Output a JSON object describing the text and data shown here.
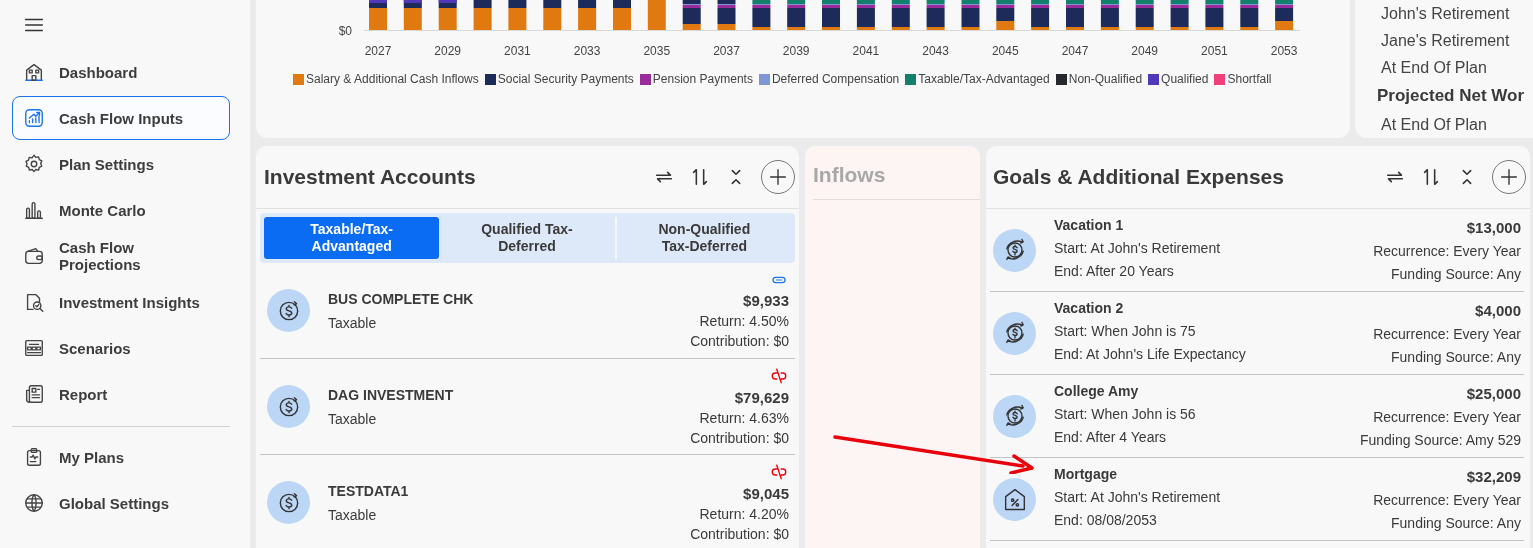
{
  "sidebar": {
    "items": [
      {
        "label": "Dashboard",
        "selected": false
      },
      {
        "label": "Cash Flow Inputs",
        "selected": true
      },
      {
        "label": "Plan Settings",
        "selected": false
      },
      {
        "label": "Monte Carlo",
        "selected": false
      },
      {
        "label": "Cash Flow Projections",
        "selected": false
      },
      {
        "label": "Investment Insights",
        "selected": false
      },
      {
        "label": "Scenarios",
        "selected": false
      },
      {
        "label": "Report",
        "selected": false
      }
    ],
    "footer_items": [
      {
        "label": "My Plans",
        "selected": false
      },
      {
        "label": "Global Settings",
        "selected": false
      }
    ]
  },
  "chart": {
    "y_tick": "$0",
    "x_labels": [
      "2027",
      "2029",
      "2031",
      "2033",
      "2035",
      "2037",
      "2039",
      "2041",
      "2043",
      "2045",
      "2047",
      "2049",
      "2051",
      "2053"
    ],
    "legend": [
      {
        "label": "Salary & Additional Cash Inflows",
        "color": "#e07a10"
      },
      {
        "label": "Social Security Payments",
        "color": "#1c2b5a"
      },
      {
        "label": "Pension Payments",
        "color": "#9b2a9b"
      },
      {
        "label": "Deferred Compensation",
        "color": "#7f97d6"
      },
      {
        "label": "Taxable/Tax-Advantaged",
        "color": "#13806c"
      },
      {
        "label": "Non-Qualified",
        "color": "#25292e"
      },
      {
        "label": "Qualified",
        "color": "#5038b8"
      },
      {
        "label": "Shortfall",
        "color": "#f0407a"
      }
    ]
  },
  "summary": {
    "lines": [
      {
        "kind": "item",
        "text": "John's Retirement"
      },
      {
        "kind": "item",
        "text": "Jane's Retirement"
      },
      {
        "kind": "item",
        "text": "At End Of Plan"
      },
      {
        "kind": "heading",
        "text": "Projected Net Wor"
      },
      {
        "kind": "item",
        "text": "At End Of Plan"
      }
    ]
  },
  "investment_accounts": {
    "title": "Investment Accounts",
    "tabs": [
      {
        "label": "Taxable/Tax-Advantaged",
        "selected": true
      },
      {
        "label": "Qualified Tax-Deferred",
        "selected": false
      },
      {
        "label": "Non-Qualified Tax-Deferred",
        "selected": false
      }
    ],
    "accounts": [
      {
        "name": "BUS COMPLETE CHK",
        "type": "Taxable",
        "linked": true,
        "amount": "$9,933",
        "return": "Return: 4.50%",
        "contribution": "Contribution: $0"
      },
      {
        "name": "DAG INVESTMENT",
        "type": "Taxable",
        "linked": false,
        "amount": "$79,629",
        "return": "Return: 4.63%",
        "contribution": "Contribution: $0"
      },
      {
        "name": "TESTDATA1",
        "type": "Taxable",
        "linked": false,
        "amount": "$9,045",
        "return": "Return: 4.20%",
        "contribution": "Contribution: $0"
      }
    ]
  },
  "inflows": {
    "title": "Inflows"
  },
  "goals": {
    "title": "Goals & Additional Expenses",
    "items": [
      {
        "kind": "expense",
        "name": "Vacation 1",
        "start": "Start: At John's Retirement",
        "end": "End: After 20 Years",
        "amount": "$13,000",
        "recurrence": "Recurrence: Every Year",
        "funding": "Funding Source: Any"
      },
      {
        "kind": "expense",
        "name": "Vacation 2",
        "start": "Start: When John is 75",
        "end": "End: At John's Life Expectancy",
        "amount": "$4,000",
        "recurrence": "Recurrence: Every Year",
        "funding": "Funding Source: Any"
      },
      {
        "kind": "expense",
        "name": "College Amy",
        "start": "Start: When John is 56",
        "end": "End: After 4 Years",
        "amount": "$25,000",
        "recurrence": "Recurrence: Every Year",
        "funding": "Funding Source: Amy 529"
      },
      {
        "kind": "loan",
        "name": "Mortgage",
        "start": "Start: At John's Retirement",
        "end": "End: 08/08/2053",
        "amount": "$32,209",
        "recurrence": "Recurrence: Every Year",
        "funding": "Funding Source: Any"
      }
    ]
  }
}
